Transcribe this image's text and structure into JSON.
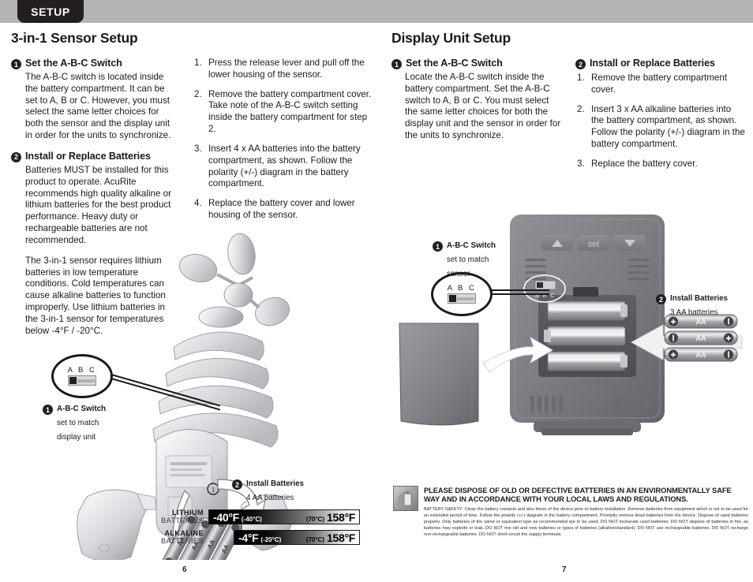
{
  "header": {
    "tab_label": "SETUP"
  },
  "left_page": {
    "title": "3-in-1 Sensor Setup",
    "step1": {
      "number": "1",
      "title": "Set the A-B-C Switch",
      "body": "The A-B-C switch is located inside the battery compartment. It can be set to A, B or C. However, you must select the same letter choices for both the sensor and the display unit in order for the units to synchronize."
    },
    "step2": {
      "number": "2",
      "title": "Install or Replace Batteries",
      "body1": "Batteries MUST be installed for this product to operate. AcuRite recommends high quality alkaline or lithium batteries for the best product performance. Heavy duty or rechargeable batteries are not recommended.",
      "body2": "The 3-in-1 sensor requires lithium batteries in low temperature conditions. Cold temperatures can cause alkaline batteries to function improperly. Use lithium batteries in the 3-in-1 sensor for temperatures below -4°F / -20°C."
    },
    "procedure": [
      {
        "n": "1.",
        "text": "Press the release lever and pull off the lower housing of the sensor."
      },
      {
        "n": "2.",
        "text": "Remove the battery compartment cover. Take note of the A-B-C switch setting inside the battery compartment for step 2."
      },
      {
        "n": "3.",
        "text": "Insert 4 x AA batteries into the battery compartment, as shown. Follow the polarity (+/-) diagram in the battery compartment."
      },
      {
        "n": "4.",
        "text": "Replace the battery cover and lower housing of the sensor."
      }
    ],
    "callout_abc": {
      "number": "1",
      "letters": "A B C",
      "title": "A-B-C Switch",
      "sub1": "set to match",
      "sub2": "display unit"
    },
    "callout_batteries": {
      "number": "2",
      "title": "Install Batteries",
      "sub": "4 AA batteries"
    },
    "temperature": {
      "rows": [
        {
          "label_line1": "LITHIUM",
          "label_line2": "BATTERIES",
          "low_f": "-40°F",
          "low_c": "(-40°C)",
          "high_c": "(70°C)",
          "high_f": "158°F"
        },
        {
          "label_line1": "ALKALINE",
          "label_line2": "BATTERIES",
          "low_f": "-4°F",
          "low_c": "(-20°C)",
          "high_c": "(70°C)",
          "high_f": "158°F"
        }
      ]
    },
    "page_number": "6"
  },
  "right_page": {
    "title": "Display Unit Setup",
    "step1": {
      "number": "1",
      "title": "Set the A-B-C Switch",
      "body": "Locate the A-B-C switch inside the battery compartment. Set the A-B-C switch to A, B or C. You must select the same letter choices for both the display unit and the sensor in order for the units to synchronize."
    },
    "step2": {
      "number": "2",
      "title": "Install or Replace Batteries",
      "items": [
        {
          "n": "1.",
          "text": "Remove the battery compartment cover."
        },
        {
          "n": "2.",
          "text": "Insert 3 x AA alkaline batteries into the battery compartment, as shown. Follow the polarity (+/-) diagram in the battery compartment."
        },
        {
          "n": "3.",
          "text": "Replace the battery cover."
        }
      ]
    },
    "callout_abc": {
      "number": "1",
      "letters": "A B C",
      "title": "A-B-C Switch",
      "sub1": "set to match",
      "sub2": "sensor"
    },
    "callout_batteries": {
      "number": "2",
      "title": "Install Batteries",
      "sub": "3 AA batteries"
    },
    "device": {
      "button_set": "set",
      "button_up": "▲",
      "button_down": "▼",
      "switch_letters": "A B C"
    },
    "battery_labels": [
      "AA",
      "AA",
      "AA"
    ],
    "notice": {
      "headline": "PLEASE DISPOSE OF OLD OR DEFECTIVE BATTERIES IN AN ENVIRONMENTALLY SAFE WAY AND IN ACCORDANCE WITH YOUR LOCAL LAWS AND REGULATIONS.",
      "fine_print": "BATTERY SAFETY: Clean the battery contacts and also those of the device prior to battery installation. Remove batteries from equipment which is not to be used for an extended period of time. Follow the polarity (+/-) diagram in the battery compartment. Promptly remove dead batteries from the device. Dispose of used batteries properly. Only batteries of the same or equivalent type as recommended are to be used. DO NOT incinerate used batteries. DO NOT dispose of batteries in fire, as batteries may explode or leak. DO NOT mix old and new batteries or types of batteries (alkaline/standard). DO NOT use rechargeable batteries. DO NOT recharge non-rechargeable batteries. DO NOT short-circuit the supply terminals."
    },
    "page_number": "7"
  }
}
